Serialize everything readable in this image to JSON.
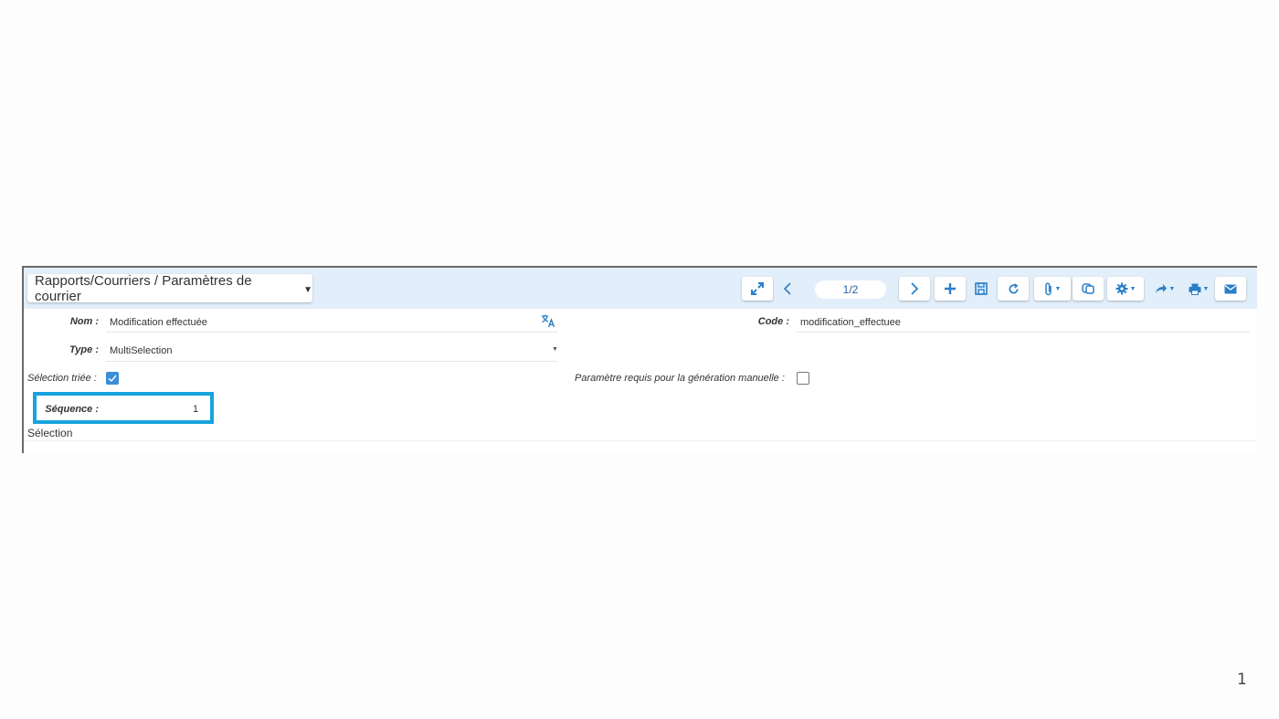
{
  "header": {
    "breadcrumb": "Rapports/Courriers / Paramètres de courrier",
    "pager": "1/2"
  },
  "toolbar": {
    "buttons": [
      "expand-icon",
      "previous-icon",
      "next-icon",
      "add-icon",
      "save-icon",
      "refresh-icon",
      "attachment-icon",
      "duplicate-icon",
      "gear-icon",
      "share-icon",
      "print-icon",
      "mail-icon"
    ]
  },
  "form": {
    "nom": {
      "label": "Nom :",
      "value": "Modification effectuée"
    },
    "code": {
      "label": "Code :",
      "value": "modification_effectuee"
    },
    "type": {
      "label": "Type :",
      "value": "MultiSelection"
    },
    "selection_triee": {
      "label": "Sélection triée :",
      "checked": true
    },
    "parametre_requis": {
      "label": "Paramètre requis pour la génération manuelle :",
      "checked": false
    },
    "sequence": {
      "label": "Séquence :",
      "value": "1"
    },
    "section_title": "Sélection"
  },
  "colors": {
    "accent": "#2a7fc9",
    "highlight": "#17a3dd",
    "toolbar_bg": "#e2eef9"
  },
  "slide_number": "1"
}
